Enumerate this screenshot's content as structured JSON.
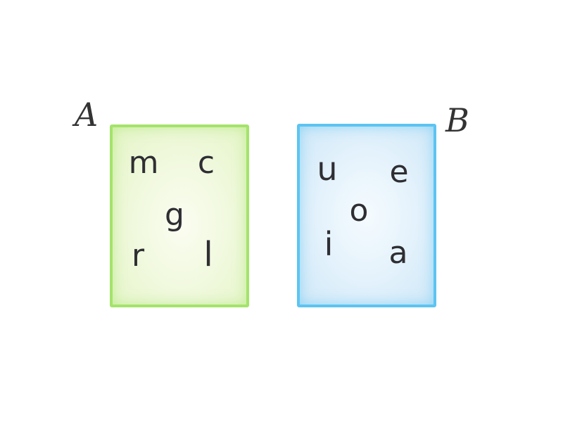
{
  "sets": {
    "a": {
      "label": "A",
      "color": "#a4e36a",
      "letters": [
        "m",
        "c",
        "g",
        "r",
        "l"
      ]
    },
    "b": {
      "label": "B",
      "color": "#5cc4f2",
      "letters": [
        "u",
        "e",
        "o",
        "i",
        "a"
      ]
    }
  }
}
